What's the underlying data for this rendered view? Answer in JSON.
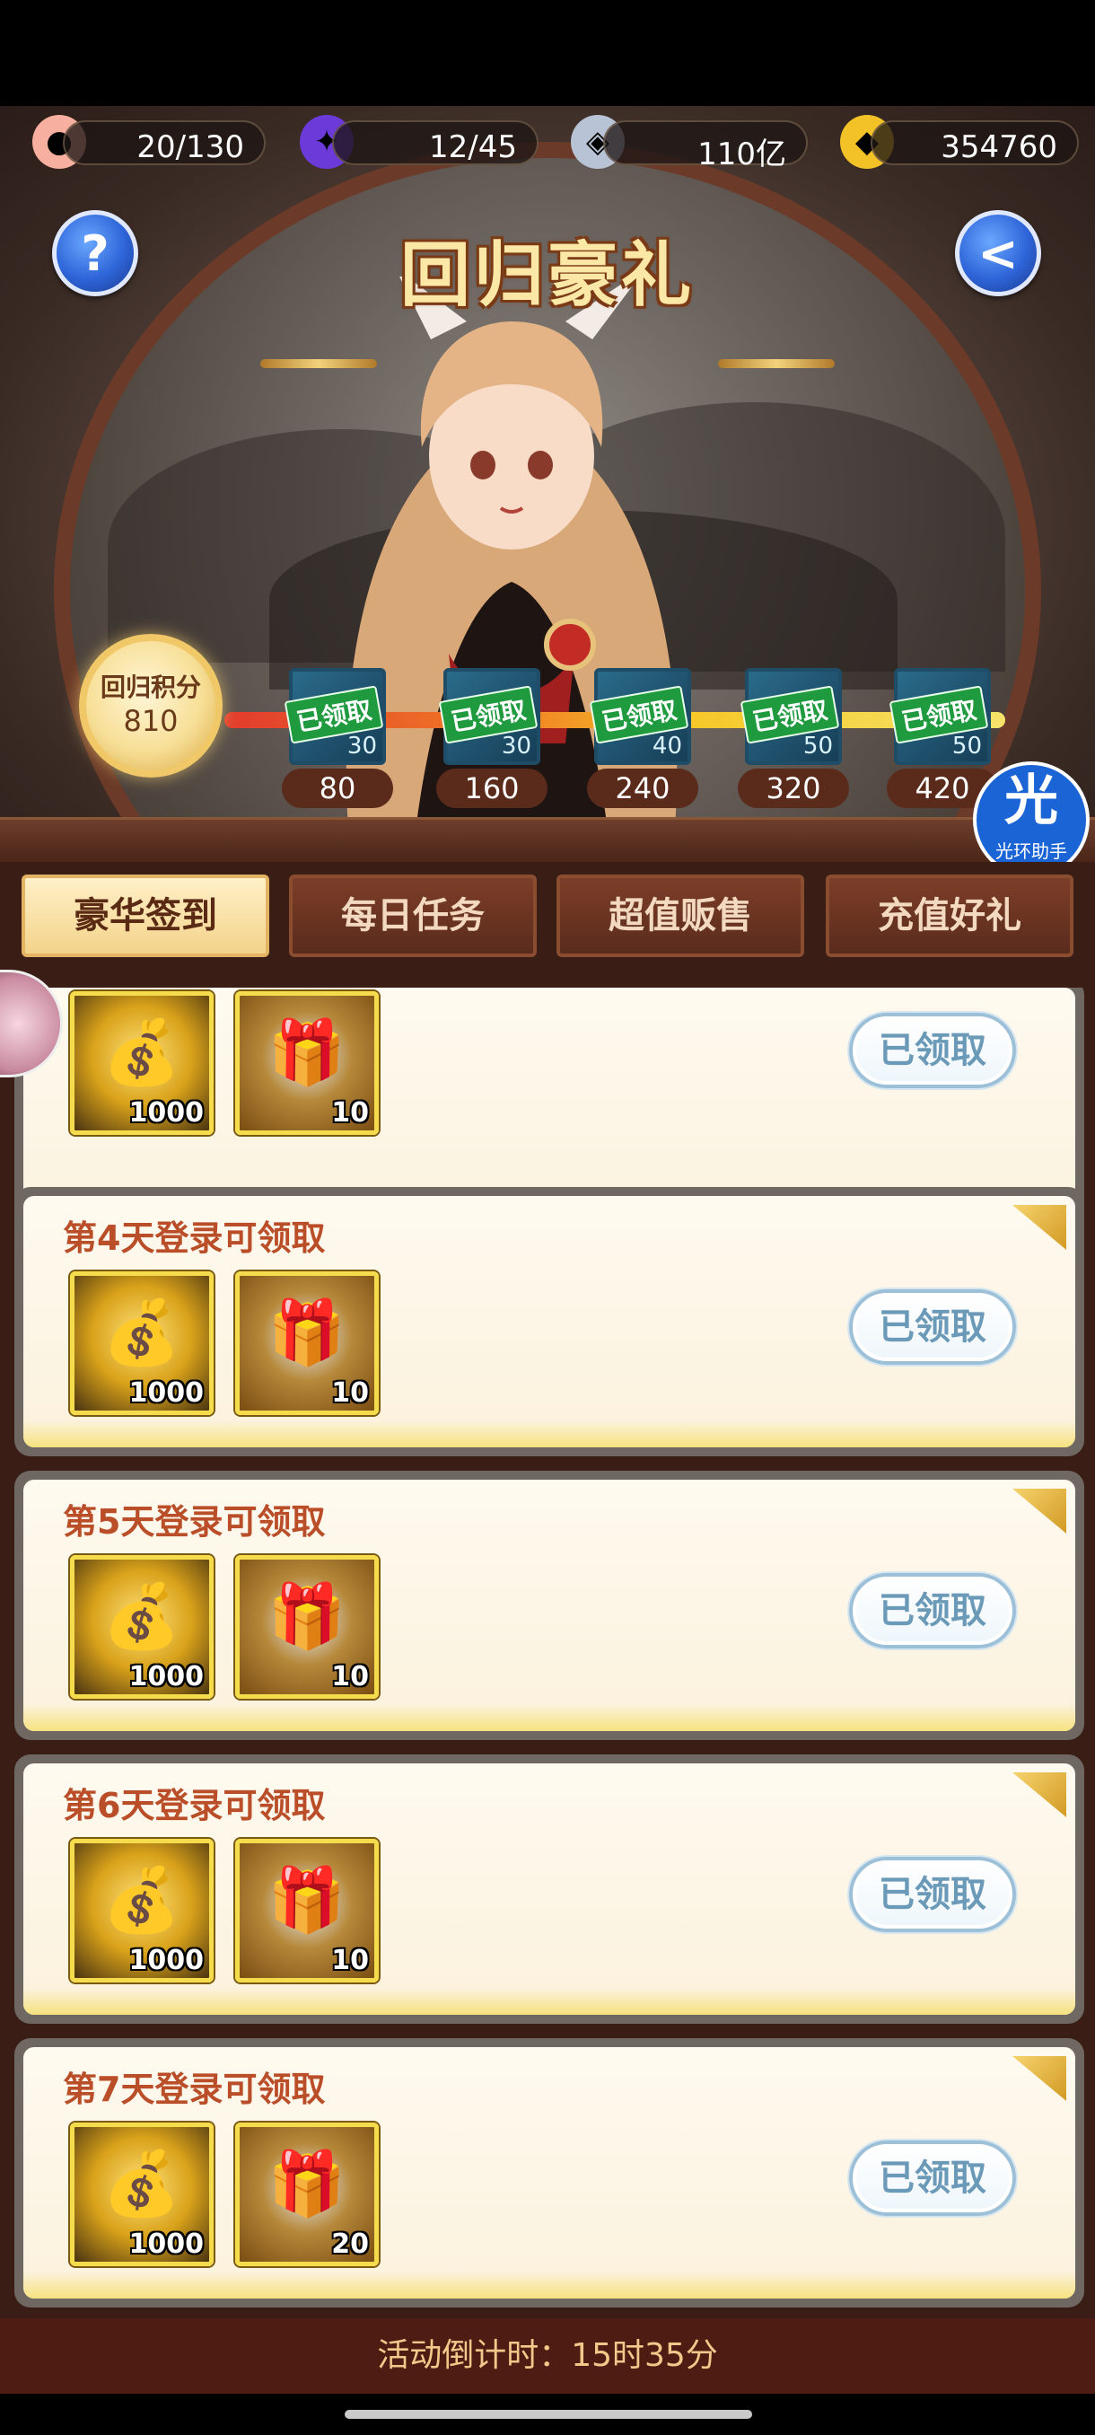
{
  "header": {
    "resources": [
      {
        "icon": "peach-icon",
        "value": "20/130"
      },
      {
        "icon": "spirit-flame-icon",
        "value": "12/45"
      },
      {
        "icon": "coin-icon",
        "value": "110亿"
      },
      {
        "icon": "gold-ingot-icon",
        "value": "354760"
      }
    ]
  },
  "banner": {
    "title": "回归豪礼",
    "help_glyph": "?",
    "back_glyph": "<",
    "points_label": "回归积分",
    "points_value": "810",
    "milestones": [
      {
        "claimed_label": "已领取",
        "item_count": "30",
        "threshold": "80"
      },
      {
        "claimed_label": "已领取",
        "item_count": "30",
        "threshold": "160"
      },
      {
        "claimed_label": "已领取",
        "item_count": "40",
        "threshold": "240"
      },
      {
        "claimed_label": "已领取",
        "item_count": "50",
        "threshold": "320"
      },
      {
        "claimed_label": "已领取",
        "item_count": "50",
        "threshold": "420"
      }
    ],
    "helper_badge": {
      "big": "光",
      "small": "光环助手"
    }
  },
  "tabs": [
    {
      "label": "豪华签到",
      "active": true
    },
    {
      "label": "每日任务",
      "active": false
    },
    {
      "label": "超值贩售",
      "active": false
    },
    {
      "label": "充值好礼",
      "active": false
    }
  ],
  "rewards": [
    {
      "title": "",
      "items": [
        {
          "type": "gold",
          "qty": "1000"
        },
        {
          "type": "chest",
          "qty": "10"
        }
      ],
      "button": "已领取"
    },
    {
      "title": "第4天登录可领取",
      "items": [
        {
          "type": "gold",
          "qty": "1000"
        },
        {
          "type": "chest",
          "qty": "10"
        }
      ],
      "button": "已领取"
    },
    {
      "title": "第5天登录可领取",
      "items": [
        {
          "type": "gold",
          "qty": "1000"
        },
        {
          "type": "chest",
          "qty": "10"
        }
      ],
      "button": "已领取"
    },
    {
      "title": "第6天登录可领取",
      "items": [
        {
          "type": "gold",
          "qty": "1000"
        },
        {
          "type": "chest",
          "qty": "10"
        }
      ],
      "button": "已领取"
    },
    {
      "title": "第7天登录可领取",
      "items": [
        {
          "type": "gold",
          "qty": "1000"
        },
        {
          "type": "chest",
          "qty": "20"
        }
      ],
      "button": "已领取"
    }
  ],
  "footer": {
    "countdown": "活动倒计时：15时35分"
  },
  "colors": {
    "accent_title": "#b94e28",
    "tab_active": "#f3d38a",
    "claimed_button_text": "#6b9ab8"
  }
}
